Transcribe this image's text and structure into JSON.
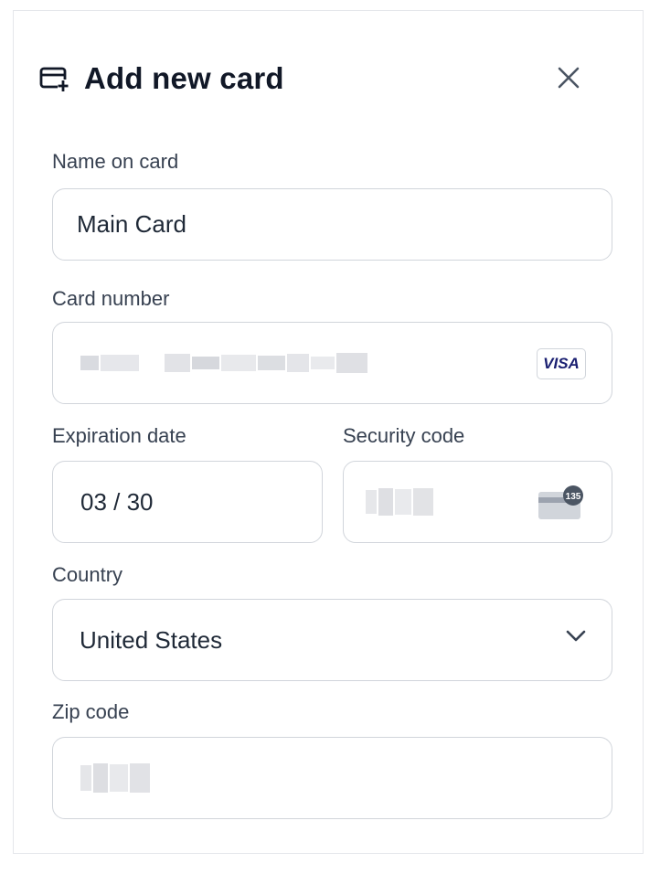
{
  "dialog": {
    "title": "Add new card",
    "icon": "card-add-icon",
    "close_icon": "close-icon"
  },
  "form": {
    "name_label": "Name on card",
    "name_value": "Main Card",
    "card_number_label": "Card number",
    "card_number_value": "",
    "card_brand": "VISA",
    "expiration_label": "Expiration date",
    "expiration_value": "03 / 30",
    "security_label": "Security code",
    "security_value": "",
    "security_hint": "135",
    "country_label": "Country",
    "country_value": "United States",
    "zip_label": "Zip code",
    "zip_value": ""
  },
  "colors": {
    "border": "#d1d5db",
    "label": "#374151",
    "text": "#1f2937",
    "visa": "#1a1f71"
  }
}
